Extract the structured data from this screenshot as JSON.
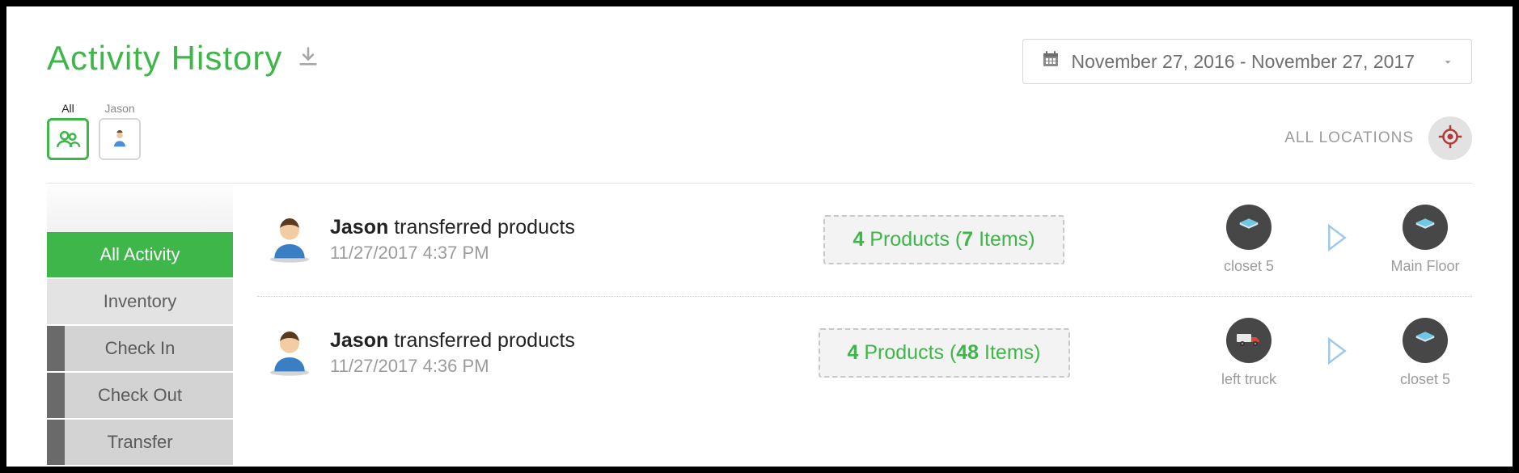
{
  "header": {
    "title": "Activity History",
    "date_range": "November 27, 2016 - November 27, 2017"
  },
  "user_filter": {
    "all_label": "All",
    "user_label": "Jason"
  },
  "locations_filter": "ALL LOCATIONS",
  "sidebar": {
    "all_activity": "All Activity",
    "inventory": "Inventory",
    "check_in": "Check In",
    "check_out": "Check Out",
    "transfer": "Transfer"
  },
  "rows": [
    {
      "actor": "Jason",
      "action": " transferred products",
      "timestamp": "11/27/2017 4:37 PM",
      "product_count": "4",
      "products_word": " Products (",
      "item_count": "7",
      "items_word": " Items)",
      "from_label": "closet 5",
      "to_label": "Main Floor",
      "from_type": "box",
      "to_type": "box"
    },
    {
      "actor": "Jason",
      "action": " transferred products",
      "timestamp": "11/27/2017 4:36 PM",
      "product_count": "4",
      "products_word": " Products (",
      "item_count": "48",
      "items_word": " Items)",
      "from_label": "left truck",
      "to_label": "closet 5",
      "from_type": "truck",
      "to_type": "box"
    }
  ]
}
